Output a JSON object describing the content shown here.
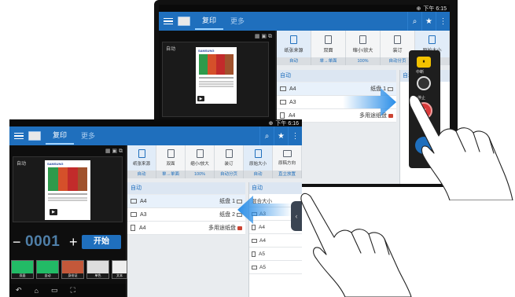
{
  "status": {
    "time": "下午 6:15",
    "time2": "下午 6:16"
  },
  "header": {
    "tab_copy": "复印",
    "tab_more": "更多"
  },
  "preview": {
    "mode_label": "自动",
    "logo": "SAMSUNG"
  },
  "options": [
    {
      "label": "纸张来源",
      "value": "自动"
    },
    {
      "label": "双面",
      "value": "单→单面"
    },
    {
      "label": "缩小/放大",
      "value": "100%"
    },
    {
      "label": "装订",
      "value": "自动分页"
    },
    {
      "label": "原始大小",
      "value": "自动"
    },
    {
      "label": "原稿方向",
      "value": "直立放置"
    }
  ],
  "source_list": {
    "header": "自动",
    "rows": [
      {
        "size": "A4",
        "tray": "纸盘 1"
      },
      {
        "size": "A3",
        "tray": "纸盘 2"
      },
      {
        "size": "A4",
        "tray": "多用途纸盘"
      }
    ]
  },
  "size_list": {
    "header": "自动",
    "rows": [
      "混合大小",
      "A3",
      "A4",
      "A4",
      "A5",
      "A5"
    ]
  },
  "counter": {
    "minus": "−",
    "value": "0001",
    "plus": "+",
    "start": "开始"
  },
  "thumbnails": [
    "双面",
    "自动",
    "身份证",
    "单色",
    "文本"
  ],
  "quick_panel": {
    "pause": "暂停",
    "interrupt": "中断",
    "stop": "停止"
  },
  "colors": {
    "accent": "#1f6fbd",
    "arrow": "#2a8ee8",
    "stop": "#d93a3a"
  },
  "icons": [
    "menu-icon",
    "copier-icon",
    "search-icon",
    "star-icon",
    "more-vertical-icon",
    "back-icon",
    "home-icon",
    "recent-apps-icon",
    "screenshot-icon",
    "globe-icon"
  ]
}
